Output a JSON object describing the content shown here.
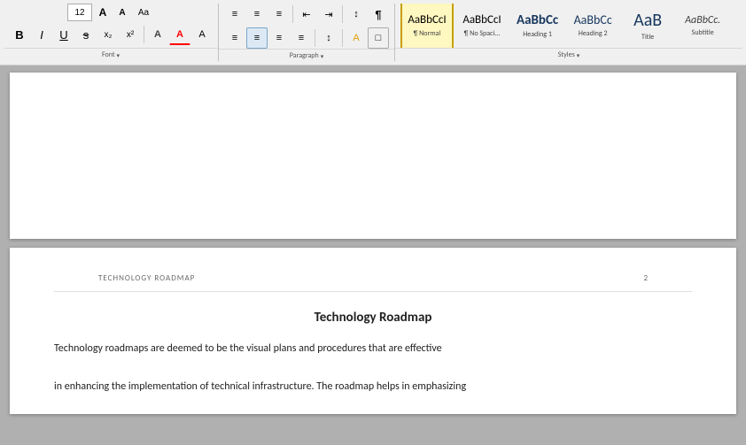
{
  "toolbar": {
    "row1": {
      "font_size": "12",
      "font_size_up_label": "A",
      "font_size_down_label": "A",
      "font_clear_label": "Aa",
      "list_bullet_icon": "☰",
      "list_number_icon": "☰",
      "list_multi_icon": "☰",
      "decrease_indent_icon": "←",
      "increase_indent_icon": "→",
      "sort_icon": "↕",
      "show_para_icon": "¶"
    },
    "row2": {
      "align_left_label": "≡",
      "align_center_label": "≡",
      "align_right_label": "≡",
      "align_justify_label": "≡",
      "line_spacing_label": "≡",
      "shading_label": "A",
      "border_label": "□"
    },
    "sections": {
      "font_label": "Font",
      "paragraph_label": "Paragraph",
      "styles_label": "Styles"
    },
    "styles": [
      {
        "id": "normal",
        "preview": "AaBbCcI",
        "label": "¶ Normal",
        "active": true
      },
      {
        "id": "no-spacing",
        "preview": "AaBbCcI",
        "label": "¶ No Spaci...",
        "active": false
      },
      {
        "id": "heading1",
        "preview": "AaBbCc",
        "label": "Heading 1",
        "active": false
      },
      {
        "id": "heading2",
        "preview": "AaBbCc",
        "label": "Heading 2",
        "active": false
      },
      {
        "id": "title",
        "preview": "AaB",
        "label": "Title",
        "active": false
      },
      {
        "id": "subtitle",
        "preview": "AaBbCc.",
        "label": "Subtitle",
        "active": false
      }
    ]
  },
  "document": {
    "page1": {
      "content": ""
    },
    "page2": {
      "header_title": "TECHNOLOGY ROADMAP",
      "page_number": "2",
      "heading": "Technology Roadmap",
      "body_line1": "Technology roadmaps are deemed to be the visual plans and procedures that are effective",
      "body_line2": "in enhancing the implementation of technical infrastructure.  The roadmap helps in emphasizing"
    }
  }
}
